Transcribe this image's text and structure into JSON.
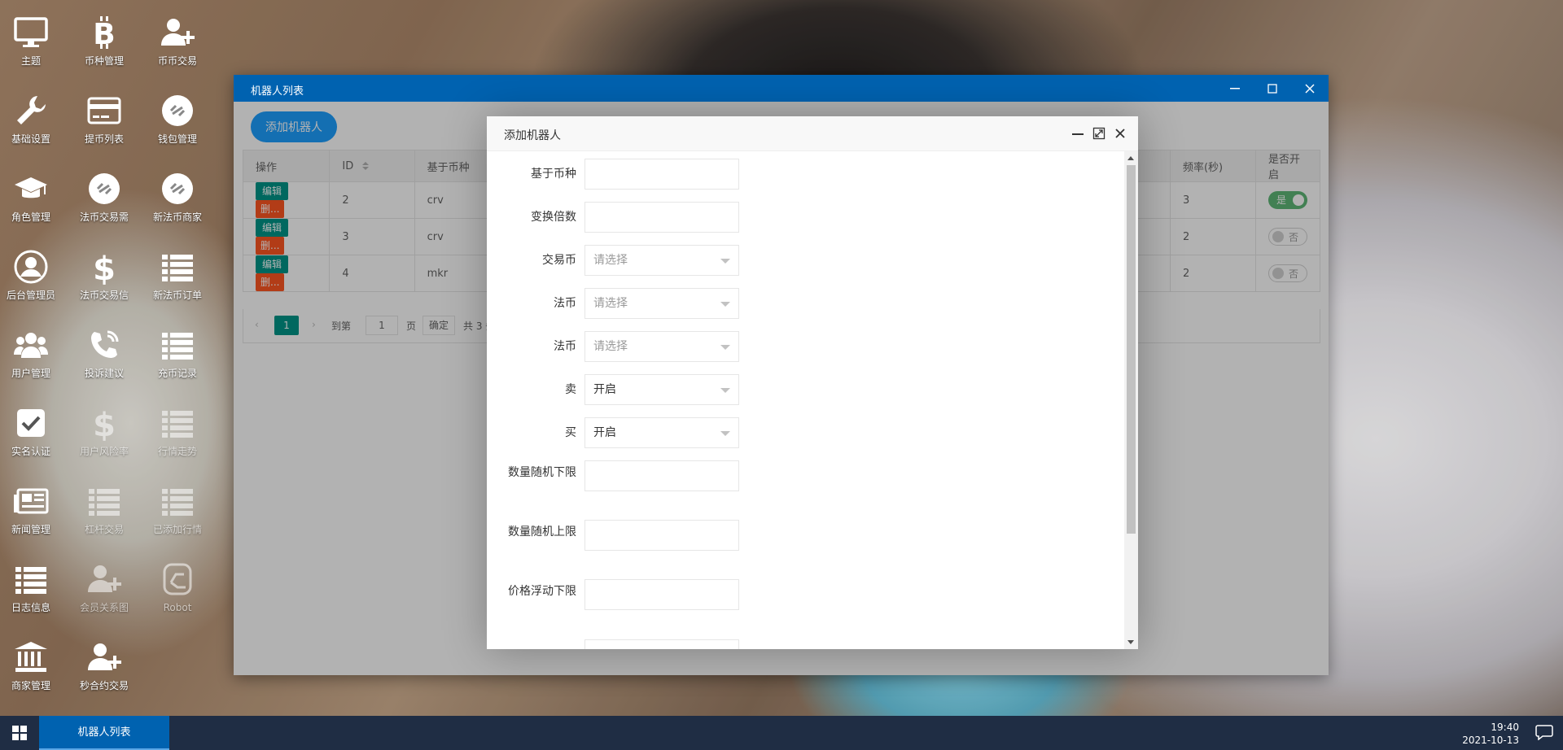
{
  "desktop": {
    "icons": [
      {
        "label": "主题",
        "icon": "monitor-icon"
      },
      {
        "label": "币种管理",
        "icon": "bitcoin-icon"
      },
      {
        "label": "币币交易",
        "icon": "user-plus-icon"
      },
      {
        "label": "基础设置",
        "icon": "wrench-icon"
      },
      {
        "label": "提币列表",
        "icon": "credit-card-icon"
      },
      {
        "label": "钱包管理",
        "icon": "link-circle-icon"
      },
      {
        "label": "角色管理",
        "icon": "graduation-cap-icon"
      },
      {
        "label": "法币交易需",
        "icon": "link-circle-icon"
      },
      {
        "label": "新法币商家",
        "icon": "link-circle-icon"
      },
      {
        "label": "后台管理员",
        "icon": "user-circle-icon"
      },
      {
        "label": "法币交易信",
        "icon": "dollar-icon"
      },
      {
        "label": "新法币订单",
        "icon": "list-icon"
      },
      {
        "label": "用户管理",
        "icon": "users-icon"
      },
      {
        "label": "投诉建议",
        "icon": "phone-icon"
      },
      {
        "label": "充币记录",
        "icon": "list-icon"
      },
      {
        "label": "实名认证",
        "icon": "checkbox-icon"
      },
      {
        "label": "用户风险率",
        "icon": "dollar-icon"
      },
      {
        "label": "行情走势",
        "icon": "list-icon"
      },
      {
        "label": "新闻管理",
        "icon": "newspaper-icon"
      },
      {
        "label": "杠杆交易",
        "icon": "list-icon"
      },
      {
        "label": "已添加行情",
        "icon": "list-icon"
      },
      {
        "label": "日志信息",
        "icon": "list-icon"
      },
      {
        "label": "会员关系图",
        "icon": "user-plus-icon"
      },
      {
        "label": "Robot",
        "icon": "hand-icon"
      },
      {
        "label": "商家管理",
        "icon": "bank-icon"
      },
      {
        "label": "秒合约交易",
        "icon": "user-plus-icon"
      }
    ]
  },
  "window": {
    "title": "机器人列表",
    "add_button": "添加机器人",
    "columns": [
      "操作",
      "ID",
      "基于币种",
      "频率(秒)",
      "是否开启"
    ],
    "rows": [
      {
        "edit": "编辑",
        "del": "删...",
        "id": "2",
        "base": "crv",
        "freq": "3",
        "enabled": "是"
      },
      {
        "edit": "编辑",
        "del": "删...",
        "id": "3",
        "base": "crv",
        "freq": "2",
        "enabled": "否"
      },
      {
        "edit": "编辑",
        "del": "删...",
        "id": "4",
        "base": "mkr",
        "freq": "2",
        "enabled": "否"
      }
    ],
    "pager": {
      "prev": "‹",
      "page": "1",
      "next": "›",
      "goto": "到第",
      "input": "1",
      "page_unit": "页",
      "confirm": "确定",
      "total": "共 3 条"
    }
  },
  "modal": {
    "title": "添加机器人",
    "fields": [
      {
        "label": "基于币种",
        "value": ""
      },
      {
        "label": "变换倍数",
        "value": ""
      },
      {
        "label": "交易币",
        "value": "",
        "placeholder": "请选择"
      },
      {
        "label": "法币",
        "value": "",
        "placeholder": "请选择"
      },
      {
        "label": "法币",
        "value": "",
        "placeholder": "请选择"
      },
      {
        "label": "卖",
        "value": "开启"
      },
      {
        "label": "买",
        "value": "开启"
      },
      {
        "label": "数量随机下限",
        "value": ""
      },
      {
        "label": "数量随机上限",
        "value": ""
      },
      {
        "label": "价格浮动下限",
        "value": ""
      }
    ]
  },
  "taskbar": {
    "task_label": "机器人列表",
    "time": "19:40",
    "date": "2021-10-13"
  },
  "colors": {
    "title_bar": "#0062b0",
    "primary_button": "#1e9fff",
    "edit_button": "#009688",
    "delete_button": "#ff5722",
    "switch_on": "#5fb878",
    "taskbar": "#1f2d44"
  }
}
